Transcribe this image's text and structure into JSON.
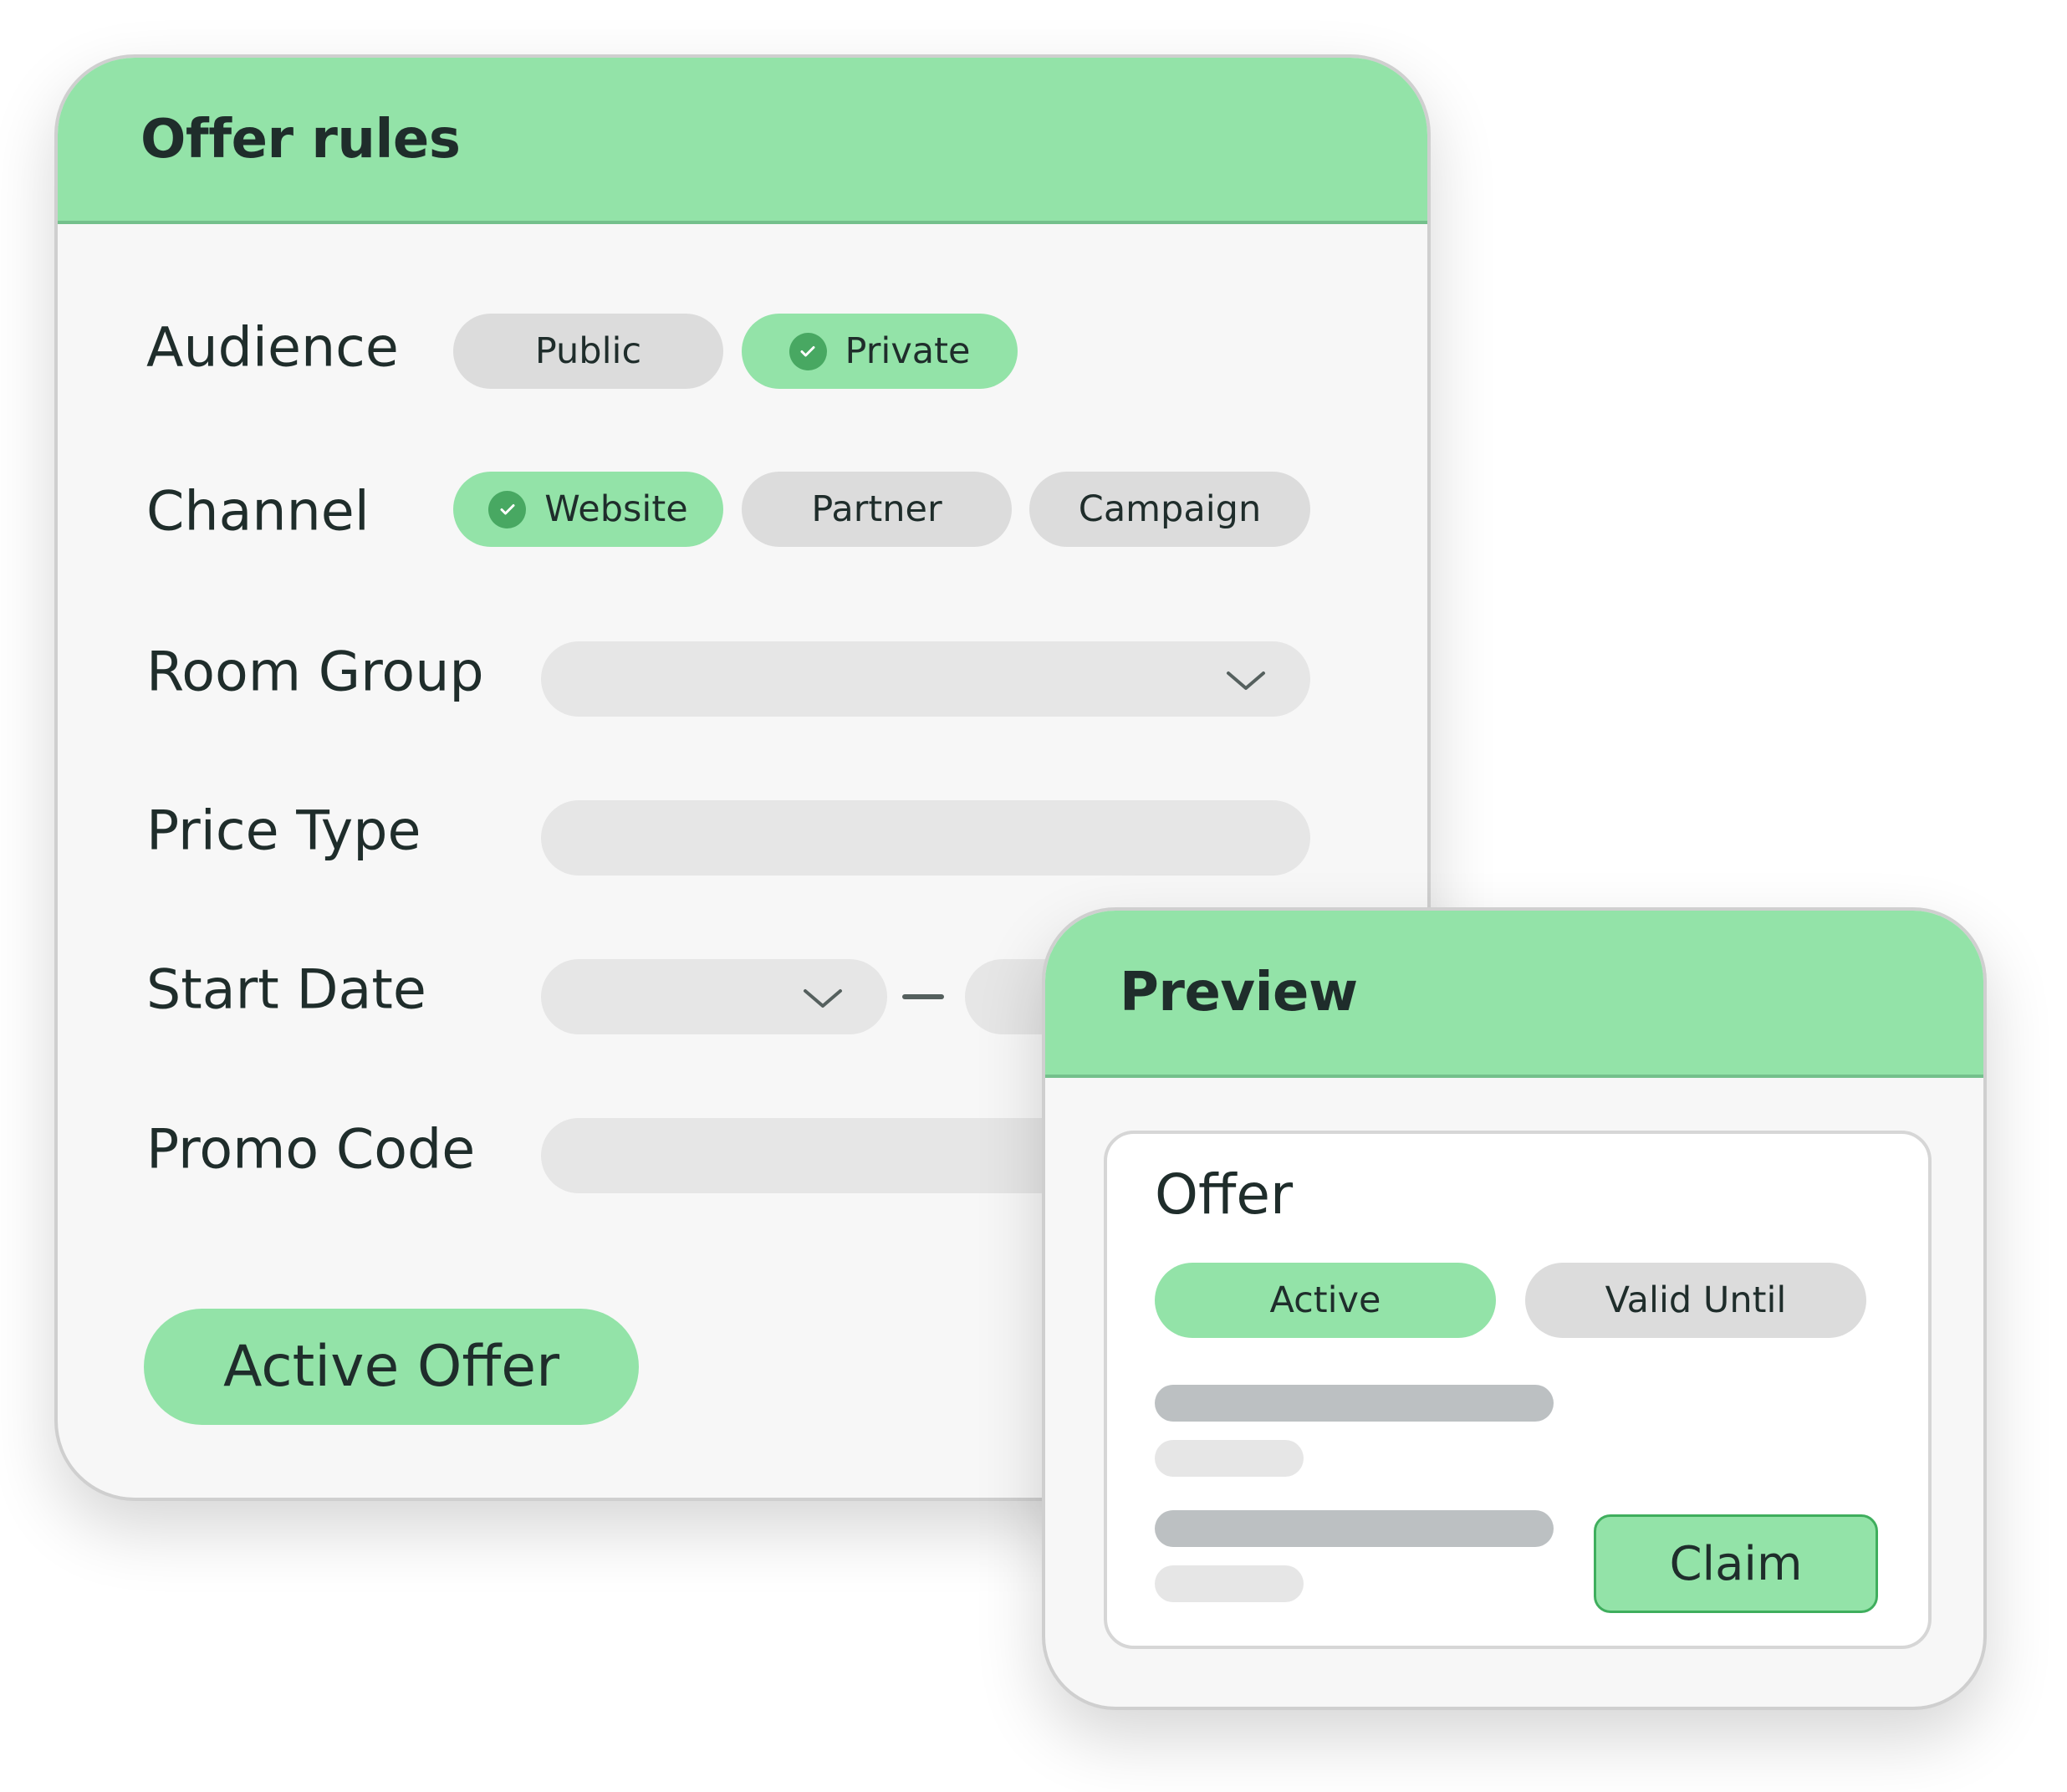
{
  "rules": {
    "title": "Offer rules",
    "audience": {
      "label": "Audience",
      "options": [
        {
          "label": "Public",
          "selected": false
        },
        {
          "label": "Private",
          "selected": true
        }
      ]
    },
    "channel": {
      "label": "Channel",
      "options": [
        {
          "label": "Website",
          "selected": true
        },
        {
          "label": "Partner",
          "selected": false
        },
        {
          "label": "Campaign",
          "selected": false
        }
      ]
    },
    "room_group": {
      "label": "Room Group",
      "value": ""
    },
    "price_type": {
      "label": "Price Type",
      "value": ""
    },
    "start_date": {
      "label": "Start Date",
      "from": "",
      "to": ""
    },
    "promo_code": {
      "label": "Promo Code",
      "value": ""
    },
    "cta_label": "Active Offer"
  },
  "preview": {
    "title": "Preview",
    "offer": {
      "title": "Offer",
      "tags": [
        {
          "label": "Active",
          "highlighted": true
        },
        {
          "label": "Valid Until",
          "highlighted": false
        }
      ],
      "claim_label": "Claim"
    }
  },
  "colors": {
    "accent_green": "#93e3a8",
    "check_green": "#48a862",
    "pill_gray": "#dcdcdc",
    "field_gray": "#e6e6e6",
    "text_dark": "#1f2d2b"
  }
}
